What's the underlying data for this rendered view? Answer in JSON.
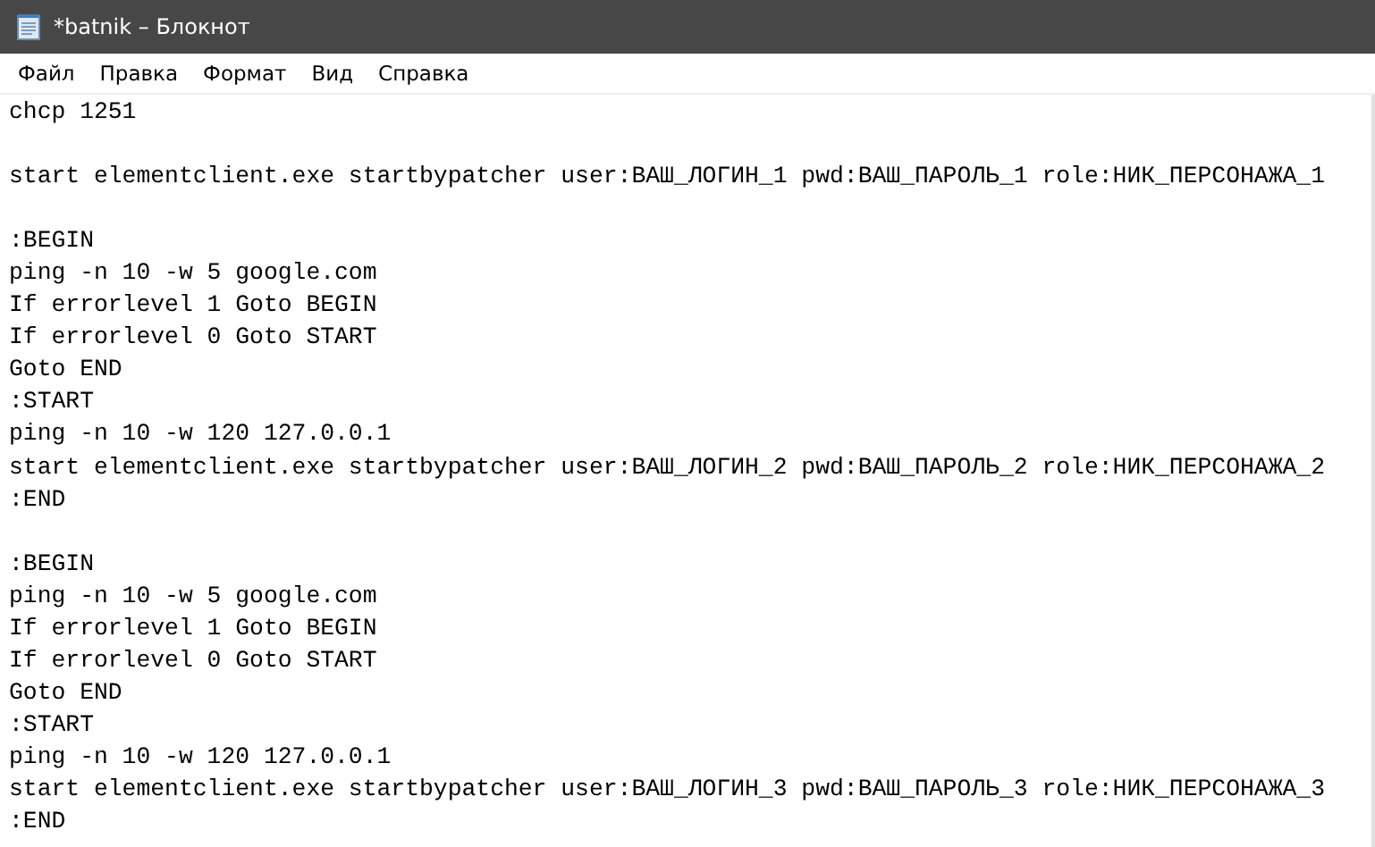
{
  "window": {
    "title": "*batnik – Блокнот"
  },
  "menu": [
    {
      "label": "Файл"
    },
    {
      "label": "Правка"
    },
    {
      "label": "Формат"
    },
    {
      "label": "Вид"
    },
    {
      "label": "Справка"
    }
  ],
  "editor": {
    "lines": [
      {
        "kind": "text",
        "text": "chcp 1251"
      },
      {
        "kind": "blank"
      },
      {
        "kind": "text",
        "text": "start elementclient.exe startbypatcher user:ВАШ_ЛОГИН_1 pwd:ВАШ_ПАРОЛЬ_1 role:НИК_ПЕРСОНАЖА_1"
      },
      {
        "kind": "blank"
      },
      {
        "kind": "text",
        "text": ":BEGIN"
      },
      {
        "kind": "text",
        "text": "ping -n 10 -w 5 google.com"
      },
      {
        "kind": "text",
        "text": "If errorlevel 1 Goto BEGIN"
      },
      {
        "kind": "text",
        "text": "If errorlevel 0 Goto START"
      },
      {
        "kind": "text",
        "text": "Goto END"
      },
      {
        "kind": "text",
        "text": ":START"
      },
      {
        "kind": "text",
        "text": "ping -n 10 -w 120 127.0.0.1"
      },
      {
        "kind": "text",
        "text": "start elementclient.exe startbypatcher user:ВАШ_ЛОГИН_2 pwd:ВАШ_ПАРОЛЬ_2 role:НИК_ПЕРСОНАЖА_2"
      },
      {
        "kind": "text",
        "text": ":END"
      },
      {
        "kind": "blank"
      },
      {
        "kind": "text",
        "text": ":BEGIN"
      },
      {
        "kind": "text",
        "text": "ping -n 10 -w 5 google.com"
      },
      {
        "kind": "text",
        "text": "If errorlevel 1 Goto BEGIN"
      },
      {
        "kind": "text",
        "text": "If errorlevel 0 Goto START"
      },
      {
        "kind": "text",
        "text": "Goto END"
      },
      {
        "kind": "text",
        "text": ":START"
      },
      {
        "kind": "text",
        "text": "ping -n 10 -w 120 127.0.0.1"
      },
      {
        "kind": "text",
        "text": "start elementclient.exe startbypatcher user:ВАШ_ЛОГИН_3 pwd:ВАШ_ПАРОЛЬ_3 role:НИК_ПЕРСОНАЖА_3"
      },
      {
        "kind": "text",
        "text": ":END"
      }
    ]
  }
}
